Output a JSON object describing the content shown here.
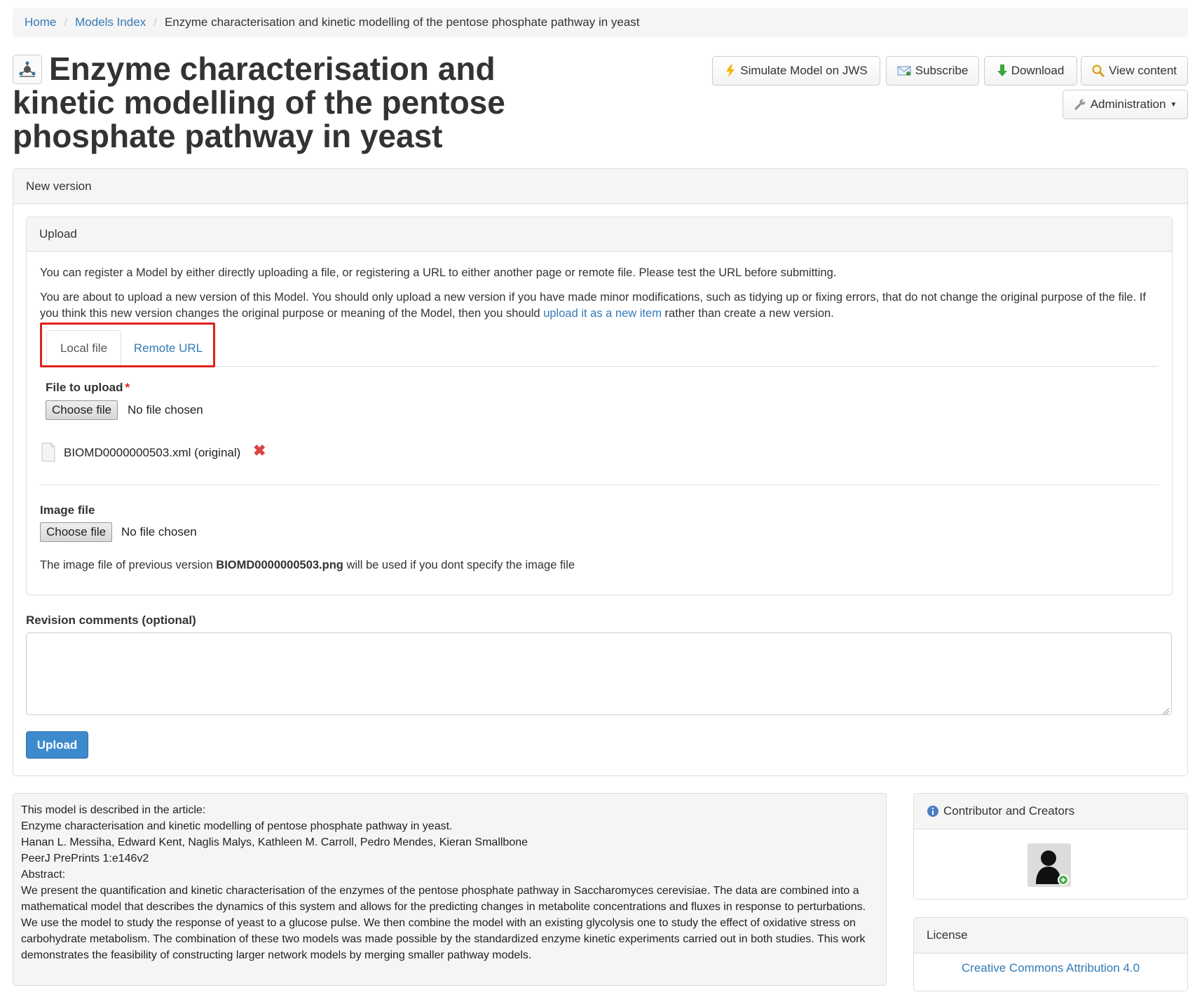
{
  "breadcrumb": {
    "home": "Home",
    "models_index": "Models Index",
    "current": "Enzyme characterisation and kinetic modelling of the pentose phosphate pathway in yeast"
  },
  "title": "Enzyme characterisation and kinetic modelling of the pentose phosphate pathway in yeast",
  "toolbar": {
    "simulate": "Simulate Model on JWS",
    "subscribe": "Subscribe",
    "download": "Download",
    "view_content": "View content",
    "administration": "Administration"
  },
  "new_version_panel": {
    "heading": "New version"
  },
  "upload_panel": {
    "heading": "Upload",
    "intro": "You can register a Model by either directly uploading a file, or registering a URL to either another page or remote file. Please test the URL before submitting.",
    "notice_before": "You are about to upload a new version of this Model. You should only upload a new version if you have made minor modifications, such as tidying up or fixing errors, that do not change the original purpose of the file. If you think this new version changes the original purpose or meaning of the Model, then you should ",
    "notice_link": "upload it as a new item",
    "notice_after": " rather than create a new version.",
    "tabs": [
      "Local file",
      "Remote URL"
    ],
    "file_label": "File to upload",
    "required_mark": "*",
    "choose_file": "Choose file",
    "no_file": "No file chosen",
    "existing_file": "BIOMD0000000503.xml (original)",
    "image_label": "Image file",
    "image_note_before": "The image file of previous version ",
    "image_note_file": "BIOMD0000000503.png",
    "image_note_after": " will be used if you dont specify the image file"
  },
  "revision": {
    "label": "Revision comments (optional)",
    "value": ""
  },
  "upload_button": "Upload",
  "description": {
    "lines": [
      "This model is described in the article:",
      "Enzyme characterisation and kinetic modelling of pentose phosphate pathway in yeast.",
      "Hanan L. Messiha, Edward Kent, Naglis Malys, Kathleen M. Carroll, Pedro Mendes, Kieran Smallbone",
      "PeerJ PrePrints 1:e146v2",
      "Abstract:",
      "We present the quantification and kinetic characterisation of the enzymes of the pentose phosphate pathway in Saccharomyces cerevisiae. The data are combined into a mathematical model that describes the dynamics of this system and allows for the predicting changes in metabolite concentrations and fluxes in response to perturbations. We use the model to study the response of yeast to a glucose pulse. We then combine the model with an existing glycolysis one to study the effect of oxidative stress on carbohydrate metabolism. The combination of these two models was made possible by the standardized enzyme kinetic experiments carried out in both studies. This work demonstrates the feasibility of constructing larger network models by merging smaller pathway models."
    ]
  },
  "contributors": {
    "heading": "Contributor and Creators"
  },
  "license": {
    "heading": "License",
    "link": "Creative Commons Attribution 4.0"
  },
  "colors": {
    "accent": "#337ab7",
    "primary_button": "#3d8bcd",
    "highlight": "#e0201c"
  }
}
